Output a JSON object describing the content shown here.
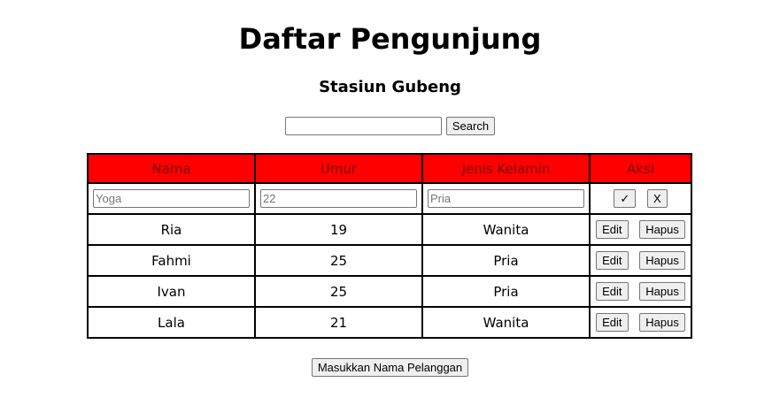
{
  "page": {
    "title": "Daftar Pengunjung",
    "subtitle": "Stasiun Gubeng"
  },
  "search": {
    "value": "",
    "placeholder": "",
    "button_label": "Search"
  },
  "table": {
    "headers": [
      "Nama",
      "Umur",
      "Jenis Kelamin",
      "Aksi"
    ],
    "new_row": {
      "nama_placeholder": "Yoga",
      "umur_placeholder": "22",
      "jenis_kelamin_placeholder": "Pria",
      "confirm_label": "✓",
      "cancel_label": "X"
    },
    "rows": [
      {
        "nama": "Ria",
        "umur": "19",
        "jenis_kelamin": "Wanita"
      },
      {
        "nama": "Fahmi",
        "umur": "25",
        "jenis_kelamin": "Pria"
      },
      {
        "nama": "Ivan",
        "umur": "25",
        "jenis_kelamin": "Pria"
      },
      {
        "nama": "Lala",
        "umur": "21",
        "jenis_kelamin": "Wanita"
      }
    ],
    "edit_label": "Edit",
    "delete_label": "Hapus"
  },
  "footer": {
    "add_button_label": "Masukkan Nama Pelanggan"
  },
  "colors": {
    "header_bg": "#ff0000",
    "header_text": "#7a0000"
  }
}
